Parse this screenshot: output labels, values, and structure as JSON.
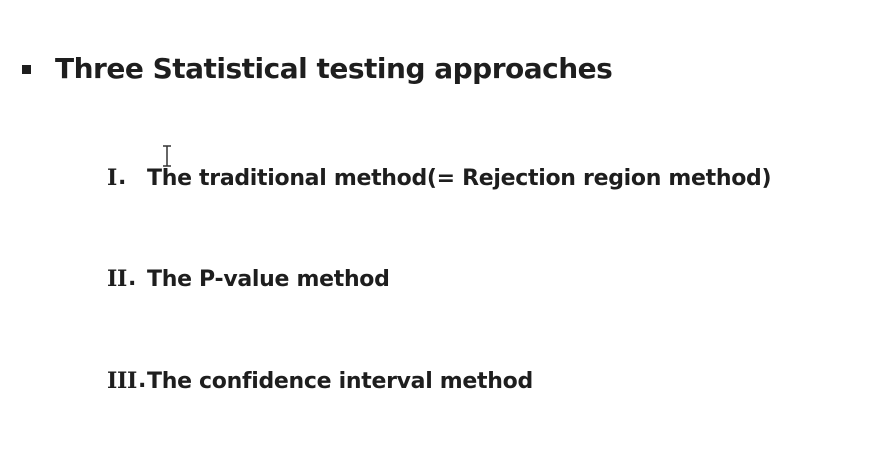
{
  "heading": "Three Statistical testing approaches",
  "items": [
    {
      "numeral": "I",
      "text": "The traditional method(= Rejection region method)"
    },
    {
      "numeral": "II",
      "text": "The P-value method"
    },
    {
      "numeral": "III",
      "text": "The confidence interval method"
    }
  ],
  "icons": {
    "bullet": "square-bullet-icon",
    "cursor": "text-cursor-icon"
  },
  "colors": {
    "text": "#1e1e1e",
    "background": "#ffffff"
  }
}
